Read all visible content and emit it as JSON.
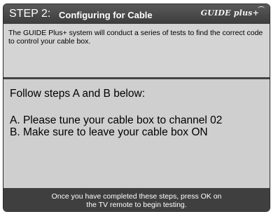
{
  "header": {
    "step": "STEP 2:",
    "title": "Configuring for Cable",
    "logo": "GUIDE plus+"
  },
  "info": {
    "text": "The GUIDE Plus+ system will conduct a series of tests to find the correct code to control your cable box."
  },
  "main": {
    "heading": "Follow steps A and B below:",
    "steps": [
      "A. Please tune your cable box to channel 02",
      "B. Make sure to leave your cable box ON"
    ]
  },
  "footer": {
    "line1": "Once you have completed these steps, press OK on",
    "line2": "the TV remote to begin testing."
  },
  "colors": {
    "header_bg": "#4a4a4a",
    "body_bg": "#d0d0d0",
    "footer_bg": "#3f3f3f",
    "text": "#000000",
    "header_text": "#ffffff"
  }
}
